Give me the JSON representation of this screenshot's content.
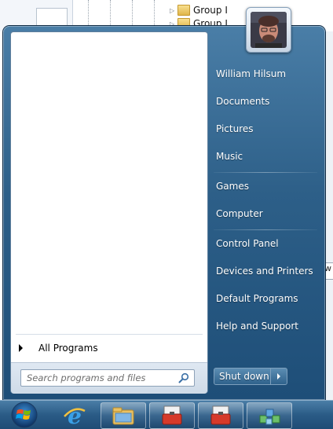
{
  "background": {
    "tree_items": [
      "Group I",
      "Group I"
    ],
    "partial_input_text": "w"
  },
  "start_menu": {
    "left_pane": {
      "all_programs_label": "All Programs",
      "search_placeholder": "Search programs and files"
    },
    "user": {
      "name": "William Hilsum"
    },
    "right_items": [
      "William Hilsum",
      "Documents",
      "Pictures",
      "Music",
      "Games",
      "Computer",
      "Control Panel",
      "Devices and Printers",
      "Default Programs",
      "Help and Support"
    ],
    "shutdown_label": "Shut down"
  },
  "taskbar": {
    "items": [
      "start-orb",
      "internet-explorer-icon",
      "windows-explorer-icon",
      "toolbox-icon",
      "toolbox-icon",
      "network-cubes-icon"
    ]
  },
  "colors": {
    "menu_top": "#4a7ea7",
    "menu_bottom": "#1e4e78",
    "text_light": "#ffffff"
  }
}
